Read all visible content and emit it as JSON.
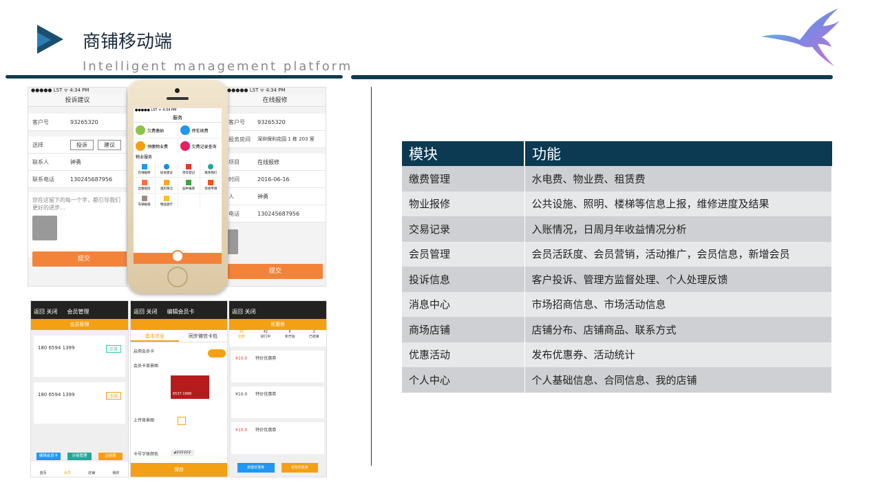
{
  "slide": {
    "title": "商铺移动端",
    "subtitle": "Intelligent management platform"
  },
  "colors": {
    "accent": "#0b3a52",
    "orange": "#f4833a",
    "amber": "#f4a015"
  },
  "table": {
    "headers": [
      "模块",
      "功能"
    ],
    "rows": [
      [
        "缴费管理",
        "水电费、物业费、租赁费"
      ],
      [
        "物业报修",
        "公共设施、照明、楼梯等信息上报，维修进度及结果"
      ],
      [
        "交易记录",
        "入账情况，日周月年收益情况分析"
      ],
      [
        "会员管理",
        "会员活跃度、会员营销，活动推广，会员信息，新增会员"
      ],
      [
        "投诉信息",
        "客户投诉、管理方监督处理、个人处理反馈"
      ],
      [
        "消息中心",
        "市场招商信息、市场活动信息"
      ],
      [
        "商场店铺",
        "店铺分布、店铺商品、联系方式"
      ],
      [
        "优惠活动",
        "发布优惠券、活动统计"
      ],
      [
        "个人中心",
        "个人基础信息、合同信息、我的店铺"
      ]
    ]
  },
  "mock_complaint": {
    "status": "●●●●● LST ᯤ 4:34 PM",
    "nav_title": "投诉建议",
    "customer_label": "客户号",
    "customer_no": "93265320",
    "choose_label": "选择",
    "opt1": "投诉",
    "opt2": "建议",
    "contact_label": "联系人",
    "contact": "钟勇",
    "phone_label": "联系电话",
    "phone": "130245687956",
    "hint": "您在这留下的每一个字，都引导我们更好的进步…",
    "submit": "提交"
  },
  "mock_repair": {
    "status": "●●●●● LST ᯤ 4:34 PM",
    "nav_title": "在线报修",
    "r1k": "客户号",
    "r1v": "93265320",
    "r2k": "报务房间",
    "r2v": "深圳保利花园 1 栋 203 室",
    "r3k": "项目",
    "r3v": "在线报修",
    "r4k": "时间",
    "r4v": "2016-06-16",
    "r5k": "人",
    "r5v": "钟勇",
    "r6k": "电话",
    "r6v": "130245687956",
    "submit": "提交"
  },
  "mock_service": {
    "status": "●●●●● LST ᯤ 4:34 PM",
    "nav_title": "服务",
    "c1": "欠费缴纳",
    "c2": "停车续费",
    "c3": "预缴物业费",
    "c4": "欠费记录查询",
    "section": "物业服务",
    "g1": "在线报修",
    "g2": "投诉建议",
    "g3": "停车登记",
    "g4": "联系我们",
    "g5": "出租租房",
    "g6": "酒店保洁",
    "g7": "园中报修",
    "g8": "装修申请",
    "g9": "车辆贴纸",
    "g10": "物品放行"
  },
  "mock_members": {
    "nav_title": "会员管理",
    "back": "返回 关闭",
    "bar": "会员管理",
    "m1": "180 6594 1399",
    "m2": "180 6594 1399",
    "tag1": "正常",
    "tag2": "冻结",
    "b1": "编辑会员卡",
    "b2": "分组管理",
    "b3": "注册表",
    "t1": "首页",
    "t2": "会员",
    "t3": "店铺",
    "t4": "我的"
  },
  "mock_card": {
    "nav_title": "编辑会员卡",
    "back": "返回 关闭",
    "tab1": "基本信息",
    "tab2": "同步微信卡包",
    "l1": "启用会员卡",
    "l2": "会员卡背景图",
    "cardno": "6537 1998",
    "l3": "上传背景图",
    "l4": "卡号字体颜色",
    "color": "#FFFFFF",
    "save": "保存"
  },
  "mock_coupon": {
    "nav_title": "优惠券",
    "back": "返回 关闭",
    "s1n": "35",
    "s1": "全部",
    "s2n": "42",
    "s2": "进行中",
    "s3n": "6",
    "s3": "未开始",
    "s4n": "2",
    "s4": "已结束",
    "price": "¥10.0",
    "name": "特价优惠券",
    "btn1": "新建优惠券",
    "btn2": "发布优惠券"
  }
}
